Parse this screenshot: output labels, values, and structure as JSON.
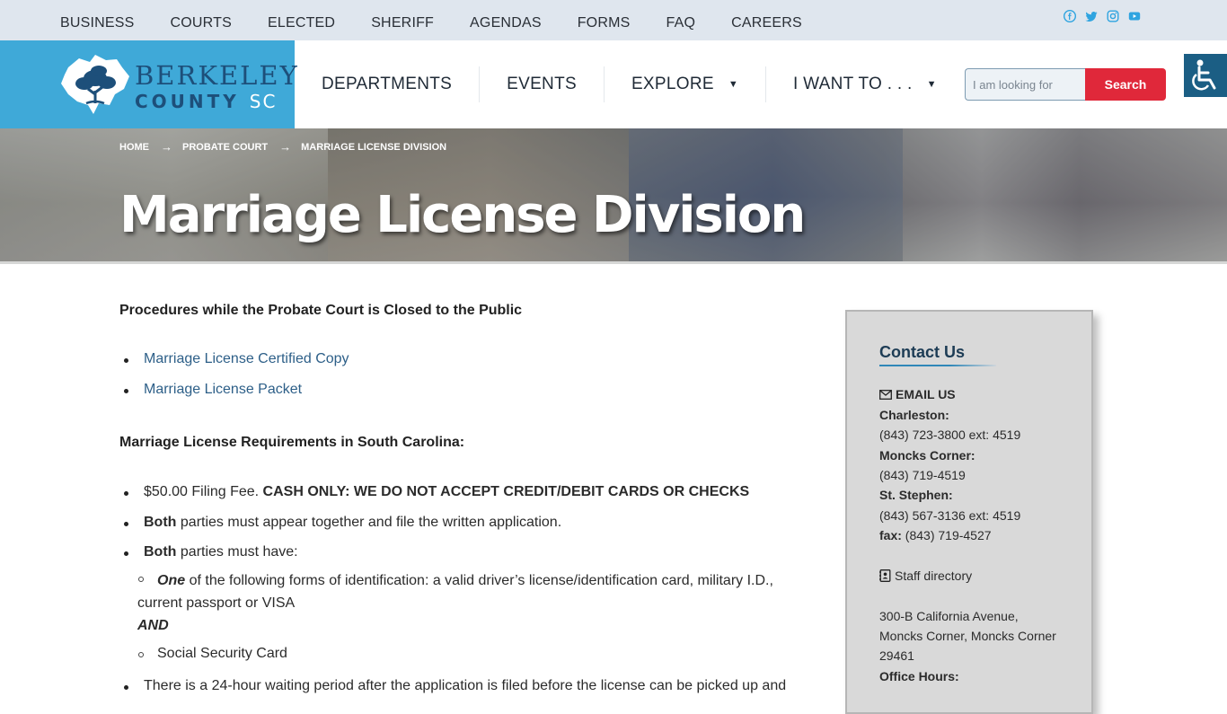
{
  "topnav": [
    "BUSINESS",
    "COURTS",
    "ELECTED",
    "SHERIFF",
    "AGENDAS",
    "FORMS",
    "FAQ",
    "CAREERS"
  ],
  "social": [
    "facebook-icon",
    "twitter-icon",
    "instagram-icon",
    "youtube-icon"
  ],
  "brand": {
    "line1": "BERKELEY",
    "line2": "COUNTY",
    "line2_suffix": "SC"
  },
  "mainnav": {
    "departments": "DEPARTMENTS",
    "events": "EVENTS",
    "explore": "EXPLORE",
    "iwantto": "I WANT TO . . ."
  },
  "search": {
    "placeholder": "I am looking for",
    "button": "Search"
  },
  "breadcrumb": {
    "home": "HOME",
    "parent": "PROBATE COURT",
    "current": "MARRIAGE LICENSE DIVISION"
  },
  "page_title": "Marriage License Division",
  "content": {
    "procedures_heading": "Procedures while the Probate Court is Closed to the Public",
    "links": [
      "Marriage License Certified Copy",
      "Marriage License Packet"
    ],
    "requirements_heading": "Marriage License Requirements in South Carolina:",
    "fee": "$50.00 Filing Fee.",
    "fee_bold": "CASH ONLY: WE DO NOT ACCEPT CREDIT/DEBIT CARDS OR CHECKS",
    "both1_bold": "Both",
    "both1_rest": "parties must appear together and file the written application.",
    "both2_bold": "Both",
    "both2_rest": "parties must have:",
    "id_one": "One",
    "id_rest": "of the following forms of identification: a valid driver’s license/identification card, military I.D.,",
    "id_rest2": "current passport or VISA",
    "and": "AND",
    "ssn": "Social Security Card",
    "waiting": "There is a 24-hour waiting period after the application is filed before the license can be picked up and"
  },
  "sidebar": {
    "title": "Contact Us",
    "email": "EMAIL US",
    "charleston_label": "Charleston:",
    "charleston_phone": "(843) 723-3800 ext: 4519",
    "moncks_label": "Moncks Corner:",
    "moncks_phone": "(843) 719-4519",
    "stephen_label": "St. Stephen:",
    "stephen_phone": "(843) 567-3136 ext: 4519",
    "fax_label": "fax:",
    "fax_phone": "(843) 719-4527",
    "staff": "Staff directory",
    "address1": "300-B California Avenue,",
    "address2": "Moncks Corner, Moncks Corner",
    "address3": "29461",
    "hours_label": "Office Hours:"
  },
  "colors": {
    "brand_blue": "#3fa9d8",
    "navy": "#1d4f7a",
    "search_red": "#e0283a",
    "link": "#2d5f88"
  }
}
